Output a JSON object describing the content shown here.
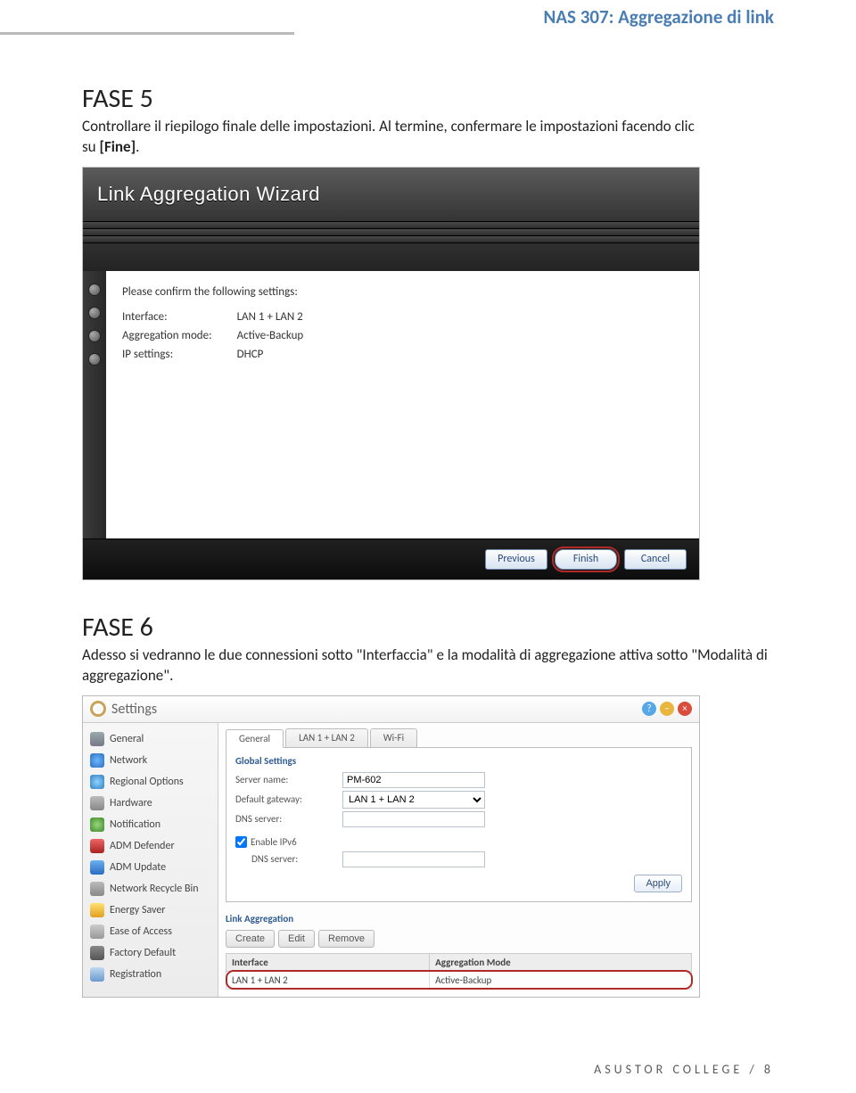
{
  "doc_title": "NAS 307: Aggregazione di link",
  "fase5": {
    "heading": "FASE 5",
    "body_line1": "Controllare il riepilogo finale delle impostazioni. Al termine, confermare le impostazioni facendo clic",
    "body_line2_prefix": "su ",
    "body_line2_bold": "[Fine]",
    "body_line2_suffix": "."
  },
  "wizard": {
    "title": "Link Aggregation Wizard",
    "confirm_text": "Please confirm the following settings:",
    "rows": [
      {
        "label": "Interface:",
        "value": "LAN 1 + LAN 2"
      },
      {
        "label": "Aggregation mode:",
        "value": "Active-Backup"
      },
      {
        "label": "IP settings:",
        "value": "DHCP"
      }
    ],
    "buttons": {
      "previous": "Previous",
      "finish": "Finish",
      "cancel": "Cancel"
    }
  },
  "fase6": {
    "heading": "FASE 6",
    "body": "Adesso si vedranno le due connessioni sotto \"Interfaccia\" e la modalità di aggregazione attiva sotto \"Modalità di aggregazione\"."
  },
  "settings": {
    "title": "Settings",
    "sidebar": [
      "General",
      "Network",
      "Regional Options",
      "Hardware",
      "Notification",
      "ADM Defender",
      "ADM Update",
      "Network Recycle Bin",
      "Energy Saver",
      "Ease of Access",
      "Factory Default",
      "Registration"
    ],
    "tabs": [
      "General",
      "LAN 1 + LAN 2",
      "Wi-Fi"
    ],
    "global_settings_title": "Global Settings",
    "server_name_label": "Server name:",
    "server_name_value": "PM-602",
    "default_gateway_label": "Default gateway:",
    "default_gateway_value": "LAN 1 + LAN 2",
    "dns_label": "DNS server:",
    "enable_ipv6_label": "Enable IPv6",
    "ipv6_dns_label": "DNS server:",
    "apply_label": "Apply",
    "link_agg_title": "Link Aggregation",
    "btn_create": "Create",
    "btn_edit": "Edit",
    "btn_remove": "Remove",
    "table": {
      "col_interface": "Interface",
      "col_mode": "Aggregation Mode",
      "row_interface": "LAN 1 + LAN 2",
      "row_mode": "Active-Backup"
    }
  },
  "footer": "ASUSTOR COLLEGE / 8"
}
